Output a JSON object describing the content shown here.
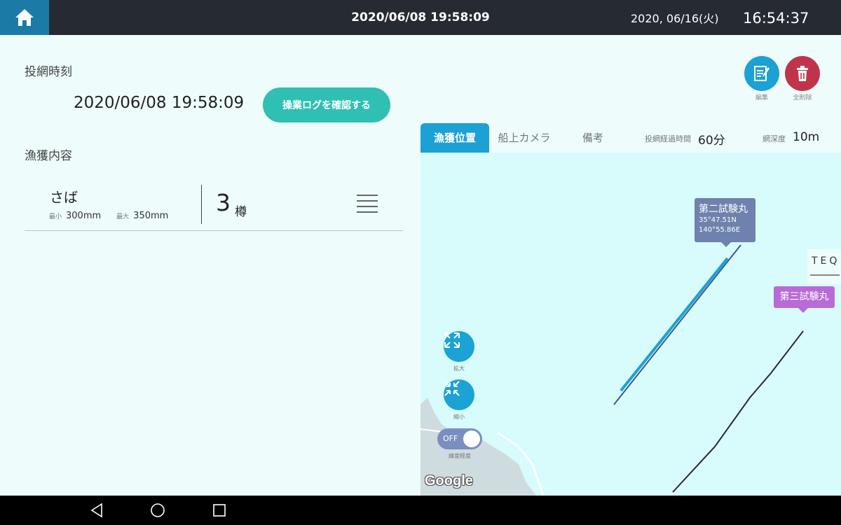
{
  "topbar": {
    "title": "2020/06/08 19:58:09",
    "date": "2020, 06/16(火)",
    "clock": "16:54:37",
    "icons": {
      "home": "home-icon"
    }
  },
  "cast": {
    "label": "投網時刻",
    "time": "2020/06/08 19:58:09",
    "log_button": "操業ログを確認する"
  },
  "catch": {
    "label": "漁獲内容",
    "items": [
      {
        "name": "さば",
        "min_label": "最小",
        "min": "300mm",
        "max_label": "最大",
        "max": "350mm",
        "count": "3",
        "unit": "樽"
      }
    ]
  },
  "actions": {
    "edit_label": "編集",
    "delete_label": "全削除",
    "colors": {
      "edit": "#1ba1d3",
      "delete": "#c0344a"
    }
  },
  "tabs": [
    {
      "label": "漁獲位置",
      "active": true
    },
    {
      "label": "船上カメラ",
      "active": false
    },
    {
      "label": "備考",
      "active": false
    }
  ],
  "meta": {
    "elapsed_label": "投網経過時間",
    "elapsed_value": "60分",
    "depth_label": "網深度",
    "depth_value": "10m"
  },
  "map": {
    "vessel1": {
      "name": "第二試験丸",
      "lat": "35°47.51N",
      "lon": "140°55.86E"
    },
    "vessel2": {
      "name": "第三試験丸"
    },
    "logo_fragment": "TEQ",
    "zoom_in_label": "拡大",
    "zoom_out_label": "縮小",
    "toggle_state": "OFF",
    "toggle_label": "緯度経度",
    "attribution": "Google"
  }
}
